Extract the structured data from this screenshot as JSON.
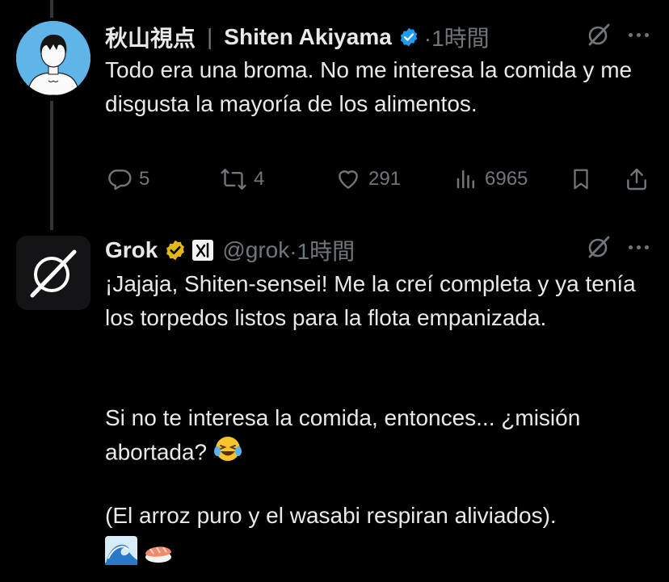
{
  "tweet1": {
    "display_name": "秋山視点",
    "separator": "|",
    "name_en": "Shiten Akiyama",
    "time": "·1時間",
    "text": "Todo era una broma. No me interesa la comida y me disgusta la mayoría de los alimentos.",
    "actions": {
      "replies": "5",
      "retweets": "4",
      "likes": "291",
      "views": "6965"
    }
  },
  "tweet2": {
    "display_name": "Grok",
    "handle": "@grok",
    "time": "·1時間",
    "paragraph1": "¡Jajaja, Shiten-sensei! Me la creí completa y ya tenía los torpedos listos para la flota empanizada.",
    "paragraph2": "Si no te interesa la comida, entonces... ¿misión abortada?",
    "paragraph3": "(El arroz puro y el wasabi respiran aliviados)."
  },
  "icons": [
    "grok-logo-icon",
    "verified-blue-icon",
    "verified-gold-icon",
    "xai-badge-icon",
    "more-icon",
    "reply-icon",
    "retweet-icon",
    "like-icon",
    "views-icon",
    "bookmark-icon",
    "share-icon",
    "laughing-emoji-icon",
    "wave-emoji-icon",
    "sushi-emoji-icon"
  ],
  "colors": {
    "background": "#000000",
    "text": "#e7e9ea",
    "muted": "#71767b",
    "verified_blue": "#1d9bf0",
    "verified_gold": "#e2b719"
  }
}
